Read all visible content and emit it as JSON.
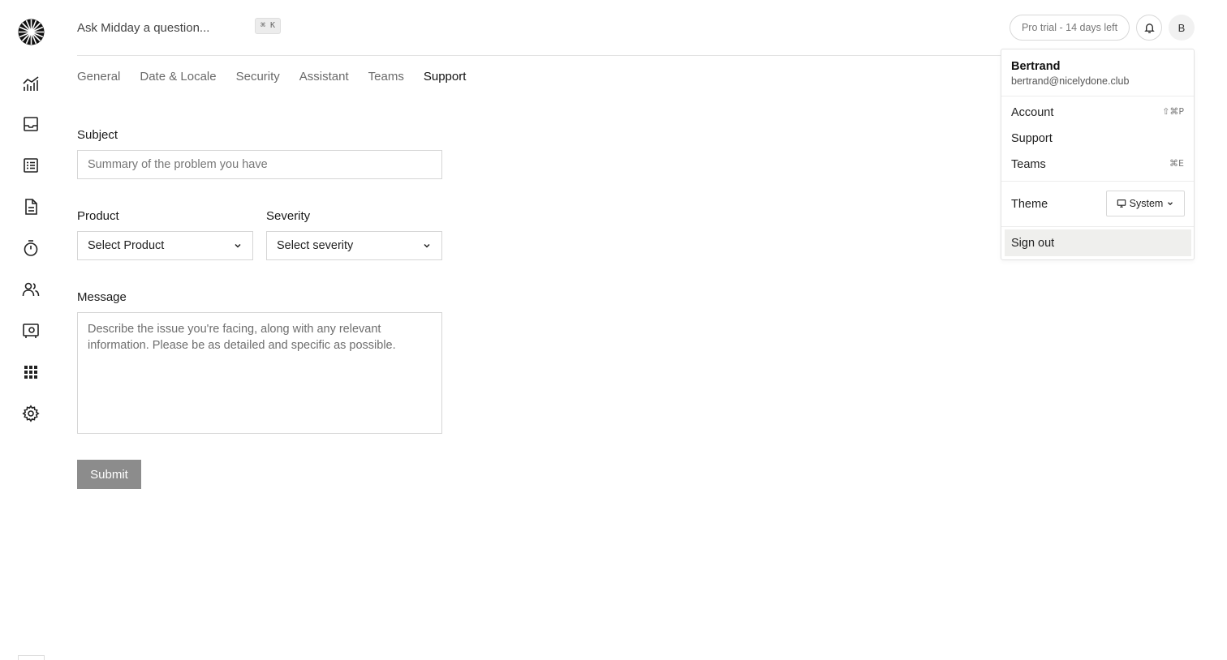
{
  "header": {
    "search_placeholder": "Ask Midday a question...",
    "search_shortcut": "⌘ K",
    "trial_badge": "Pro trial - 14 days left",
    "avatar_initial": "B"
  },
  "sidebar": {
    "icons": [
      "analytics-chart-icon",
      "inbox-icon",
      "transactions-list-icon",
      "invoice-document-icon",
      "tracker-timer-icon",
      "customers-icon",
      "vault-icon",
      "apps-grid-icon",
      "settings-gear-icon"
    ]
  },
  "tabs": [
    {
      "label": "General"
    },
    {
      "label": "Date & Locale"
    },
    {
      "label": "Security"
    },
    {
      "label": "Assistant"
    },
    {
      "label": "Teams"
    },
    {
      "label": "Support",
      "active": true
    }
  ],
  "form": {
    "subject_label": "Subject",
    "subject_placeholder": "Summary of the problem you have",
    "product_label": "Product",
    "product_value": "Select Product",
    "severity_label": "Severity",
    "severity_value": "Select severity",
    "message_label": "Message",
    "message_placeholder": "Describe the issue you're facing, along with any relevant information. Please be as detailed and specific as possible.",
    "submit_label": "Submit"
  },
  "user_menu": {
    "name": "Bertrand",
    "email": "bertrand@nicelydone.club",
    "items": [
      {
        "label": "Account",
        "shortcut": "⇧⌘P"
      },
      {
        "label": "Support",
        "shortcut": ""
      },
      {
        "label": "Teams",
        "shortcut": "⌘E"
      }
    ],
    "theme_label": "Theme",
    "theme_value": "System",
    "sign_out": "Sign out"
  }
}
